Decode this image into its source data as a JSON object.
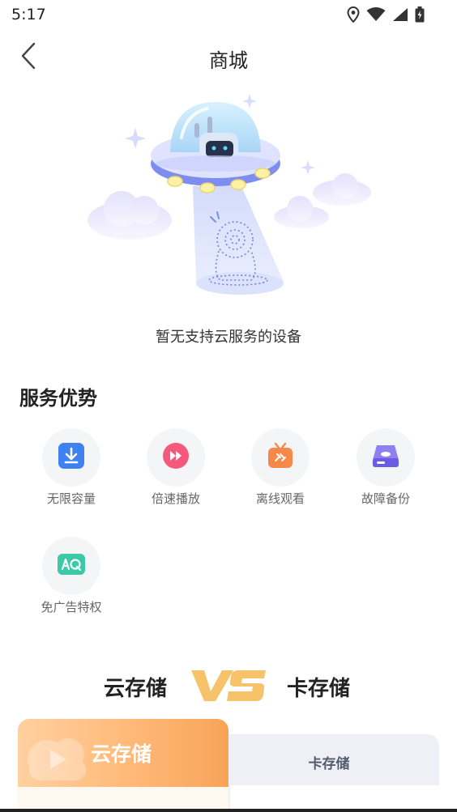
{
  "status_bar": {
    "time": "5:17",
    "icons": [
      "location-icon",
      "wifi-icon",
      "signal-icon",
      "battery-charging-icon"
    ]
  },
  "nav": {
    "title": "商城",
    "back_icon": "chevron-left-icon"
  },
  "empty_state": {
    "message": "暂无支持云服务的设备"
  },
  "services": {
    "title": "服务优势",
    "items": [
      {
        "label": "无限容量",
        "icon": "download-icon",
        "color": "#3d82f0"
      },
      {
        "label": "倍速播放",
        "icon": "fast-forward-icon",
        "color": "#f4587a"
      },
      {
        "label": "离线观看",
        "icon": "offline-tv-icon",
        "color": "#f7884a"
      },
      {
        "label": "故障备份",
        "icon": "storage-drive-icon",
        "color": "#6b5ce6"
      },
      {
        "label": "免广告特权",
        "icon": "no-ad-icon",
        "color": "#3bc9a8"
      }
    ]
  },
  "compare": {
    "left": "云存储",
    "vs": "VS",
    "right": "卡存储"
  },
  "tabs": {
    "active": "云存储",
    "inactive": "卡存储"
  },
  "colors": {
    "accent_orange": "#f7a458",
    "vs_gold": "#f6c26a"
  }
}
